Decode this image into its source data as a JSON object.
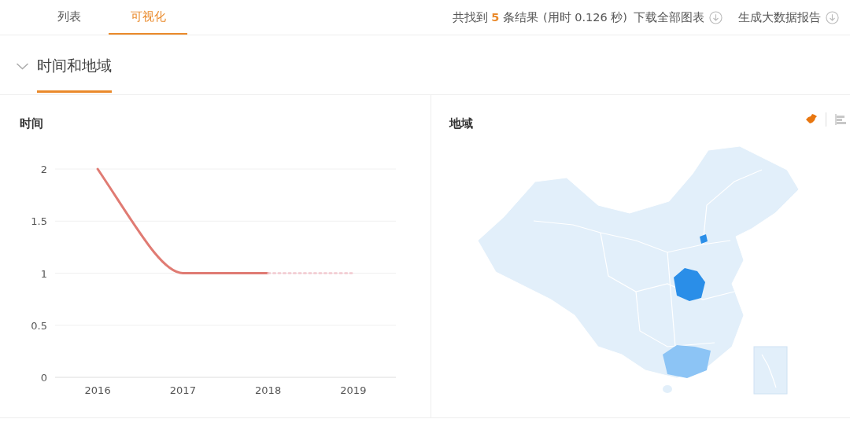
{
  "tabs": [
    {
      "label": "列表",
      "selected": false
    },
    {
      "label": "可视化",
      "selected": true
    }
  ],
  "results": {
    "summary": "共找到 **5** 条结果",
    "timing": "(用时 0.126 秒)",
    "actions": [
      "下载全部图表",
      "生成大数据报告"
    ]
  },
  "section": {
    "title": "时间和地域",
    "expanded": true,
    "time_panel": {
      "title": "时间",
      "chart_data": {
        "type": "line",
        "categories": [
          "2016",
          "2017",
          "2018",
          "2019"
        ],
        "ylim": [
          0,
          2
        ],
        "yticks": [
          0,
          0.5,
          1,
          1.5,
          2
        ],
        "grid": true,
        "series": [
          {
            "color": "#e07b73",
            "line_style": "solid",
            "values": [
              2,
              1,
              1,
              null
            ]
          },
          {
            "color": "#f2c9cf",
            "line_style": "dotted",
            "values": [
              null,
              null,
              1,
              1
            ]
          }
        ]
      }
    },
    "region_panel": {
      "title": "地域",
      "view_toggle": [
        {
          "kind": "map",
          "selected": true
        },
        {
          "kind": "bar",
          "selected": false
        }
      ]
    }
  }
}
